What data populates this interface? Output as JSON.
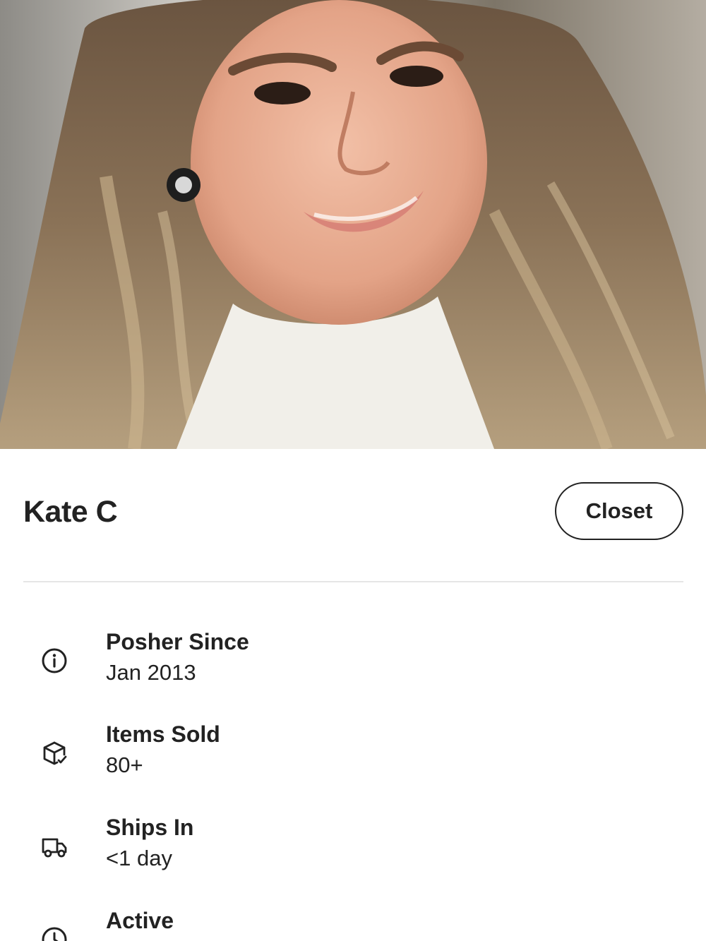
{
  "profile": {
    "name": "Kate C",
    "closet_label": "Closet"
  },
  "stats": [
    {
      "label": "Posher Since",
      "value": "Jan 2013",
      "icon": "info-icon"
    },
    {
      "label": "Items Sold",
      "value": "80+",
      "icon": "box-check-icon"
    },
    {
      "label": "Ships In",
      "value": "<1 day",
      "icon": "truck-icon"
    },
    {
      "label": "Active",
      "value": "",
      "icon": "clock-icon"
    }
  ],
  "colors": {
    "text": "#222222",
    "divider": "#e6e6e6",
    "background": "#ffffff"
  }
}
